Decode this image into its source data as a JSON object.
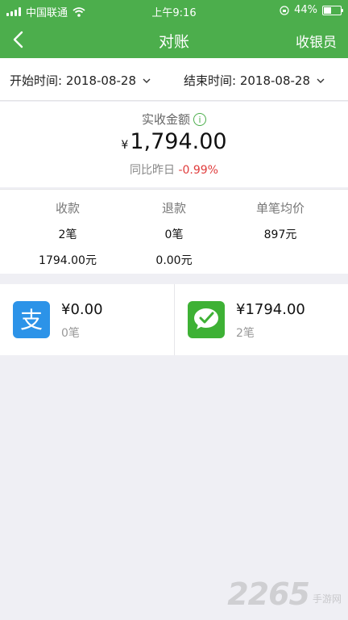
{
  "status_bar": {
    "carrier": "中国联通",
    "time": "上午9:16",
    "battery_percent": "44%",
    "battery_level": 0.44
  },
  "nav": {
    "title": "对账",
    "right_label": "收银员"
  },
  "filters": {
    "start_label": "开始时间: 2018-08-28",
    "end_label": "结束时间: 2018-08-28"
  },
  "summary": {
    "label": "实收金额",
    "currency": "¥",
    "amount": "1,794.00",
    "compare_label": "同比昨日",
    "compare_value": "-0.99%"
  },
  "stats": [
    {
      "header": "收款",
      "count": "2笔",
      "amount": "1794.00元"
    },
    {
      "header": "退款",
      "count": "0笔",
      "amount": "0.00元"
    },
    {
      "header": "单笔均价",
      "count": "897元",
      "amount": ""
    }
  ],
  "payments": [
    {
      "method": "alipay",
      "icon": "alipay-icon",
      "glyph": "支",
      "color": "#2c93e8",
      "amount": "¥0.00",
      "count": "0笔"
    },
    {
      "method": "wechat",
      "icon": "wechat-pay-icon",
      "glyph": "",
      "color": "#3eb135",
      "amount": "¥1794.00",
      "count": "2笔"
    }
  ],
  "watermark": {
    "number": "2265",
    "text": "手游网"
  }
}
